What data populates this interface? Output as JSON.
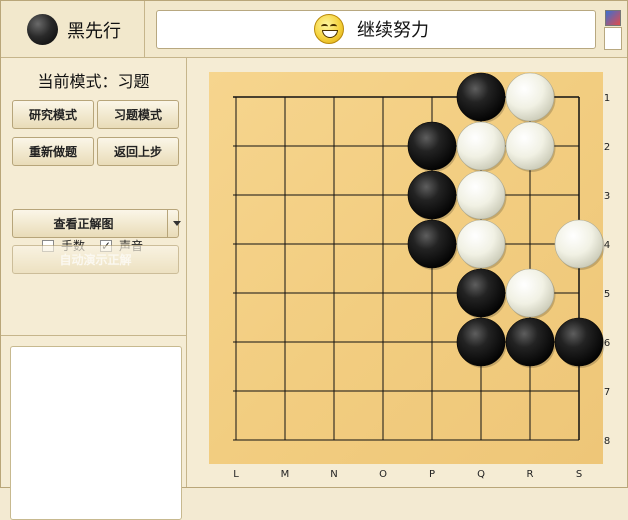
{
  "header": {
    "turn_text": "黑先行",
    "status_text": "继续努力"
  },
  "left_panel": {
    "mode_title": "当前模式：习题",
    "buttons": {
      "research_mode": "研究模式",
      "exercise_mode": "习题模式",
      "redo": "重新做题",
      "undo": "返回上步",
      "view_answer": "查看正解图",
      "auto_demo": "自动演示正解"
    },
    "checkboxes": {
      "move_numbers": {
        "label": "手数",
        "checked": false
      },
      "sound": {
        "label": "声音",
        "checked": true
      }
    }
  },
  "board": {
    "columns": [
      "L",
      "M",
      "N",
      "O",
      "P",
      "Q",
      "R",
      "S"
    ],
    "rows": [
      "1",
      "2",
      "3",
      "4",
      "5",
      "6",
      "7",
      "8"
    ],
    "stones": [
      {
        "color": "black",
        "col": "Q",
        "row": "1"
      },
      {
        "color": "white",
        "col": "R",
        "row": "1"
      },
      {
        "color": "black",
        "col": "P",
        "row": "2"
      },
      {
        "color": "white",
        "col": "Q",
        "row": "2"
      },
      {
        "color": "white",
        "col": "R",
        "row": "2"
      },
      {
        "color": "black",
        "col": "P",
        "row": "3"
      },
      {
        "color": "white",
        "col": "Q",
        "row": "3"
      },
      {
        "color": "black",
        "col": "P",
        "row": "4"
      },
      {
        "color": "white",
        "col": "Q",
        "row": "4"
      },
      {
        "color": "white",
        "col": "S",
        "row": "4"
      },
      {
        "color": "black",
        "col": "Q",
        "row": "5"
      },
      {
        "color": "white",
        "col": "R",
        "row": "5"
      },
      {
        "color": "black",
        "col": "Q",
        "row": "6"
      },
      {
        "color": "black",
        "col": "R",
        "row": "6"
      },
      {
        "color": "black",
        "col": "S",
        "row": "6"
      }
    ]
  },
  "colors": {
    "board_wood": "#f3cf84",
    "panel_bg": "#f5ecd4",
    "border": "#c6b58b"
  }
}
